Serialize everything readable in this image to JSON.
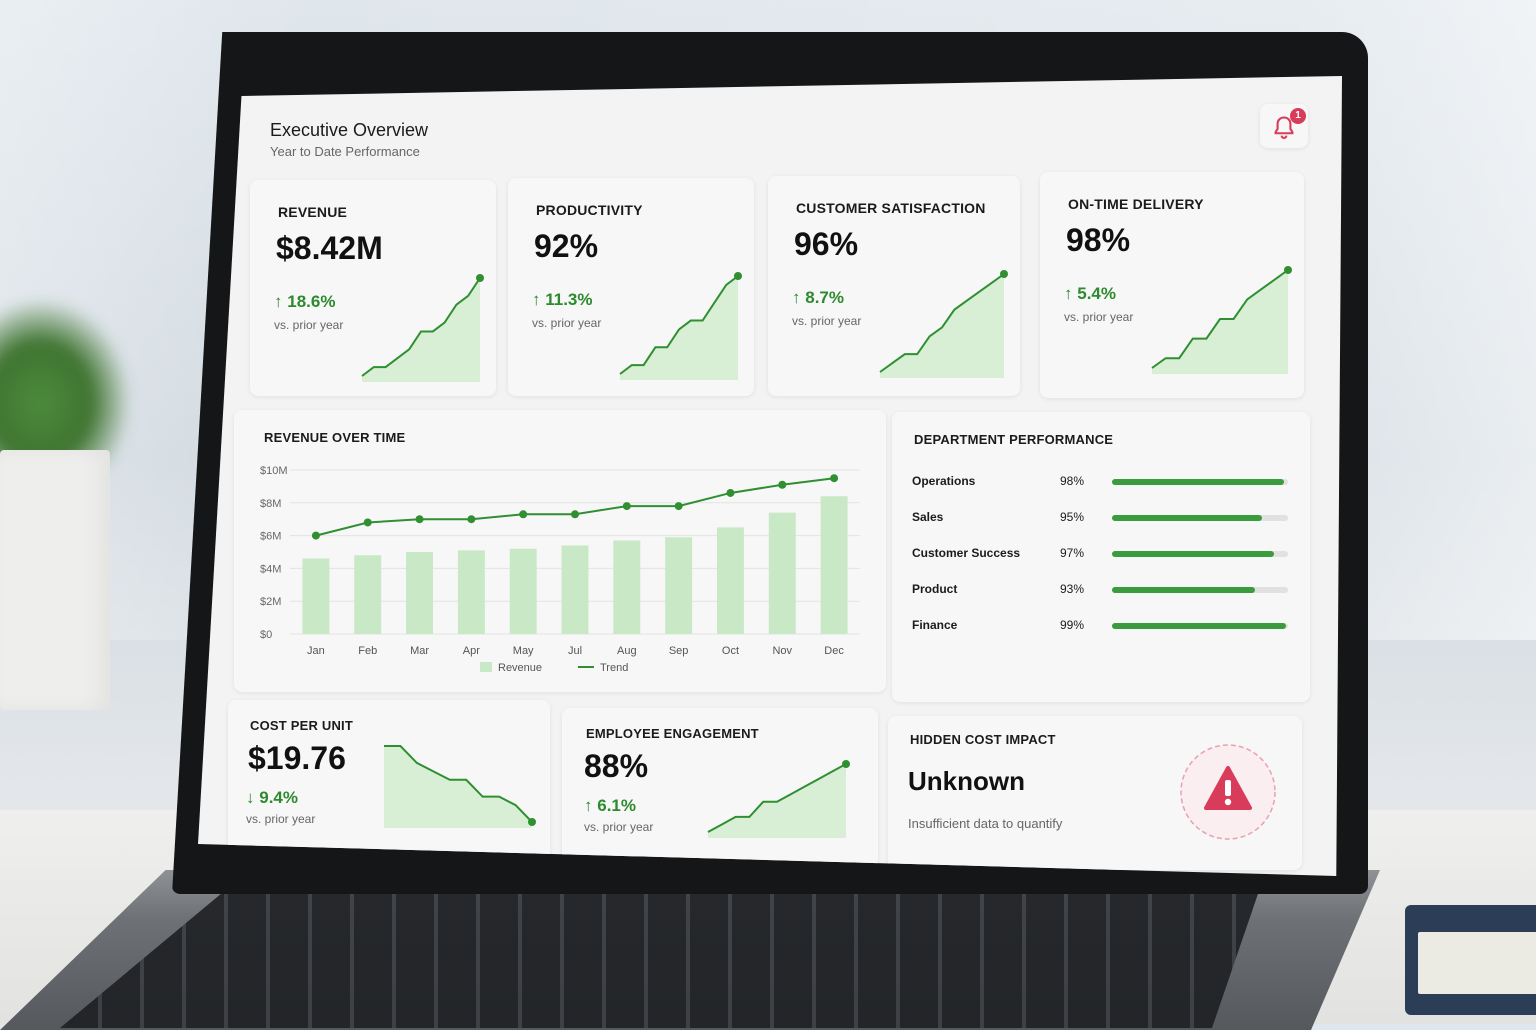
{
  "header": {
    "title": "Executive Overview",
    "subtitle": "Year to Date Performance",
    "notification_count": "1"
  },
  "kpis": [
    {
      "label": "REVENUE",
      "value": "$8.42M",
      "delta": "18.6%",
      "direction": "up",
      "note": "vs. prior year",
      "trend": [
        3,
        4,
        4,
        5,
        6,
        8,
        8,
        9,
        11,
        12,
        14
      ]
    },
    {
      "label": "PRODUCTIVITY",
      "value": "92%",
      "delta": "11.3%",
      "direction": "up",
      "note": "vs. prior year",
      "trend": [
        2,
        3,
        3,
        5,
        5,
        7,
        8,
        8,
        10,
        12,
        13
      ]
    },
    {
      "label": "CUSTOMER SATISFACTION",
      "value": "96%",
      "delta": "8.7%",
      "direction": "up",
      "note": "vs. prior year",
      "trend": [
        2,
        3,
        4,
        4,
        6,
        7,
        9,
        10,
        11,
        12,
        13
      ]
    },
    {
      "label": "ON-TIME DELIVERY",
      "value": "98%",
      "delta": "5.4%",
      "direction": "up",
      "note": "vs. prior year",
      "trend": [
        2,
        3,
        3,
        5,
        5,
        7,
        7,
        9,
        10,
        11,
        12
      ]
    }
  ],
  "revenue_chart": {
    "title": "REVENUE OVER TIME",
    "legend": {
      "bars": "Revenue",
      "line": "Trend"
    }
  },
  "chart_data": {
    "type": "bar",
    "categories": [
      "Jan",
      "Feb",
      "Mar",
      "Apr",
      "May",
      "Jul",
      "Aug",
      "Sep",
      "Oct",
      "Nov",
      "Dec"
    ],
    "series": [
      {
        "name": "Revenue",
        "type": "bar",
        "values": [
          4.6,
          4.8,
          5.0,
          5.1,
          5.2,
          5.4,
          5.7,
          5.9,
          6.5,
          7.4,
          8.4
        ]
      },
      {
        "name": "Trend",
        "type": "line",
        "values": [
          6.0,
          6.8,
          7.0,
          7.0,
          7.3,
          7.3,
          7.8,
          7.8,
          8.6,
          9.1,
          9.5
        ]
      }
    ],
    "ylim": [
      0,
      10
    ],
    "yticks": [
      "$0",
      "$2M",
      "$4M",
      "$6M",
      "$8M",
      "$10M"
    ],
    "legend": "bottom",
    "grid": true
  },
  "departments": {
    "title": "DEPARTMENT PERFORMANCE",
    "rows": [
      {
        "name": "Operations",
        "value": "98%",
        "pct": 0.98
      },
      {
        "name": "Sales",
        "value": "95%",
        "pct": 0.85
      },
      {
        "name": "Customer Success",
        "value": "97%",
        "pct": 0.92
      },
      {
        "name": "Product",
        "value": "93%",
        "pct": 0.81
      },
      {
        "name": "Finance",
        "value": "99%",
        "pct": 0.99
      }
    ]
  },
  "cost_per_unit": {
    "label": "COST PER UNIT",
    "value": "$19.76",
    "delta": "9.4%",
    "direction": "down",
    "note": "vs. prior year",
    "trend": [
      12,
      12,
      10,
      9,
      8,
      8,
      6,
      6,
      5,
      3
    ]
  },
  "engagement": {
    "label": "EMPLOYEE ENGAGEMENT",
    "value": "88%",
    "delta": "6.1%",
    "direction": "up",
    "note": "vs. prior year",
    "trend": [
      2,
      3,
      4,
      4,
      6,
      6,
      7,
      8,
      9,
      10,
      11
    ]
  },
  "hidden_cost": {
    "label": "HIDDEN COST IMPACT",
    "value": "Unknown",
    "note": "Insufficient data to quantify"
  },
  "colors": {
    "accent_green": "#3a9c3c",
    "bar_green": "#c9e8c6",
    "alert_red": "#d93b5a"
  },
  "icons": {
    "bell": "bell-icon",
    "up": "arrow-up-icon",
    "down": "arrow-down-icon",
    "warning": "warning-icon"
  }
}
